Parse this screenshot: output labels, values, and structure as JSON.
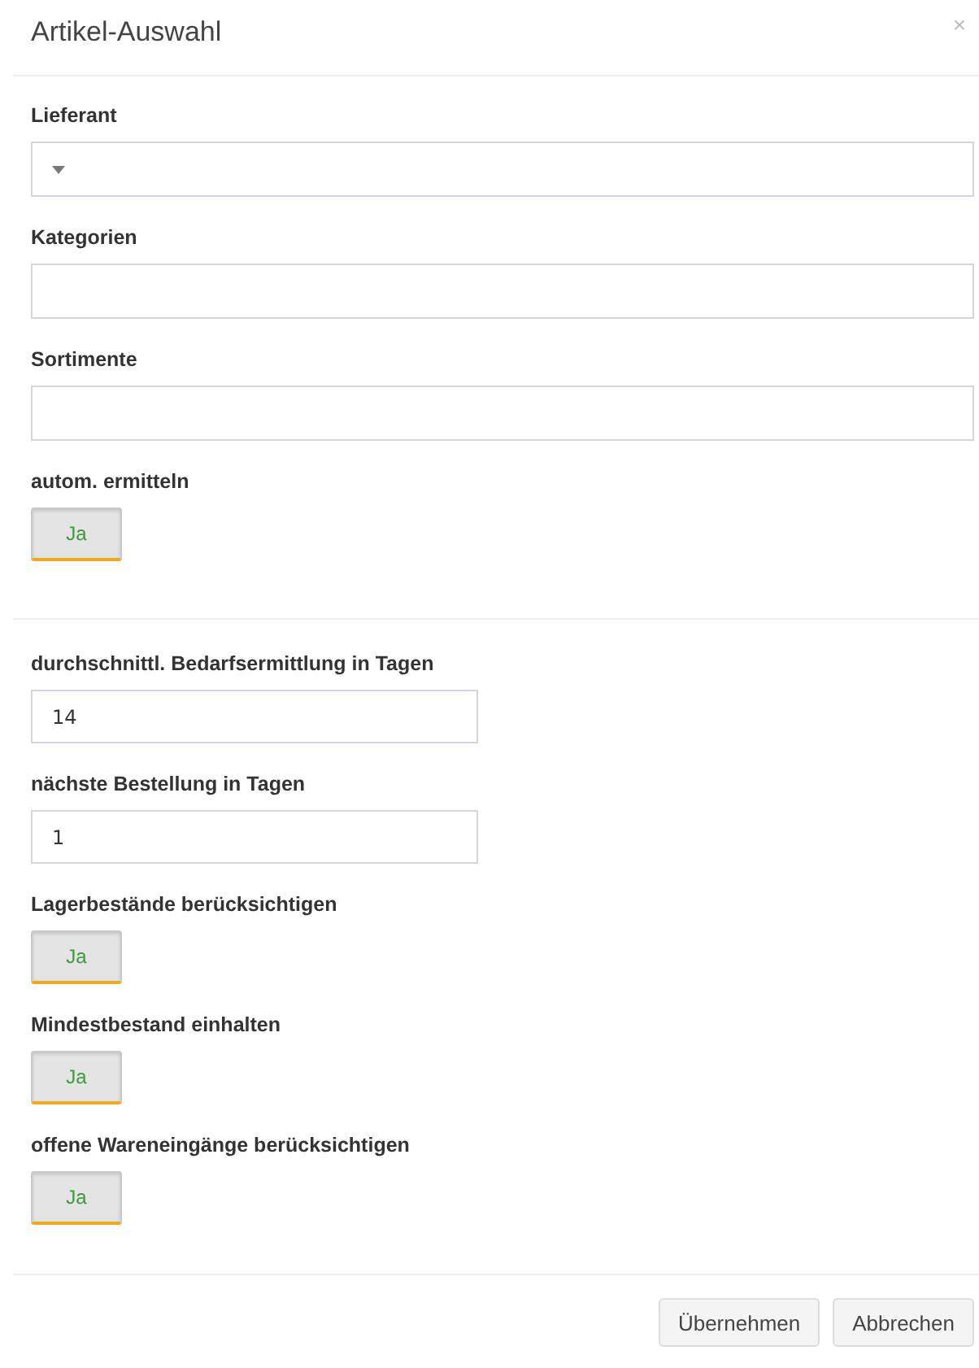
{
  "dialog": {
    "title": "Artikel-Auswahl",
    "close": "×"
  },
  "sections": [
    {
      "fields": [
        {
          "kind": "select",
          "label": "Lieferant"
        },
        {
          "kind": "text",
          "label": "Kategorien"
        },
        {
          "kind": "text",
          "label": "Sortimente"
        },
        {
          "kind": "toggle",
          "label": "autom. ermitteln",
          "value": "Ja",
          "on": true
        }
      ]
    },
    {
      "fields": [
        {
          "kind": "text",
          "label": "durchschnittl. Bedarfsermittlung in Tagen",
          "value": "14"
        },
        {
          "kind": "text",
          "label": "nächste Bestellung in Tagen",
          "value": "1"
        },
        {
          "kind": "toggle",
          "label": "Lagerbestände berücksichtigen",
          "value": "Ja",
          "on": true
        },
        {
          "kind": "toggle",
          "label": "Mindestbestand einhalten",
          "value": "Ja",
          "on": true
        },
        {
          "kind": "toggle",
          "label": "offene Wareneingänge berücksichtigen",
          "value": "Ja",
          "on": true
        }
      ]
    }
  ],
  "buttons": [
    "Übernehmen",
    "Abbrechen"
  ]
}
